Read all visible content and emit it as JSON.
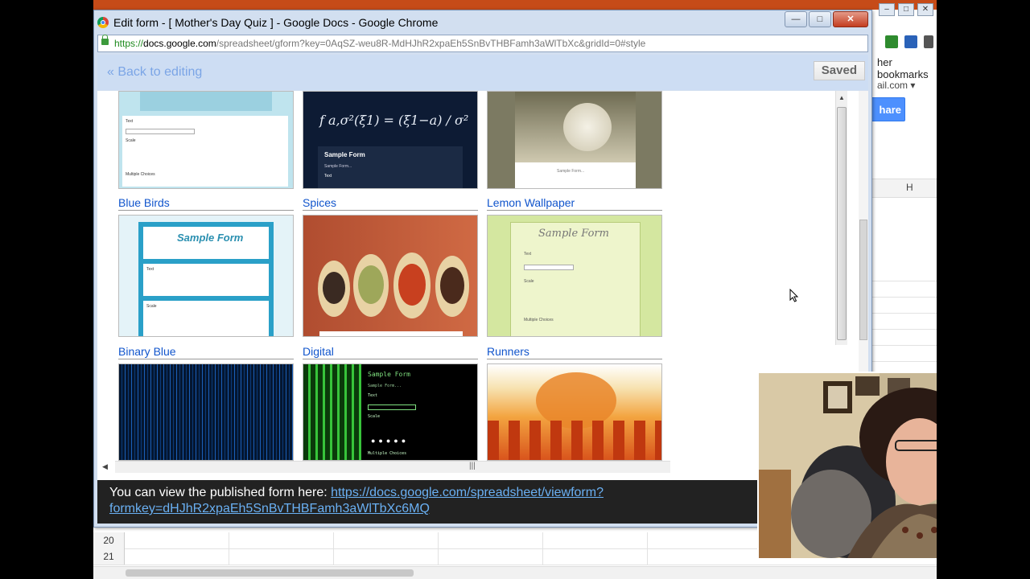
{
  "browser": {
    "window_title": "Edit form - [ Mother's Day Quiz ] - Google Docs - Google Chrome",
    "url_secure": "https://",
    "url_host": "docs.google.com",
    "url_path": "/spreadsheet/gform?key=0AqSZ-weu8R-MdHJhR2xpaEh5SnBvTHBFamh3aWlTbXc&gridId=0#style",
    "controls": {
      "minimize": "—",
      "maximize": "□",
      "close": "✕"
    }
  },
  "editor": {
    "back_link": "« Back to editing",
    "saved_label": "Saved"
  },
  "themes": [
    {
      "label": "",
      "style": "light-teal"
    },
    {
      "label": "",
      "style": "math"
    },
    {
      "label": "",
      "style": "cake"
    },
    {
      "label": "Blue Birds",
      "style": "blue-birds"
    },
    {
      "label": "Spices",
      "style": "spices"
    },
    {
      "label": "Lemon Wallpaper",
      "style": "lemon"
    },
    {
      "label": "Binary Blue",
      "style": "binary-blue"
    },
    {
      "label": "Digital",
      "style": "digital"
    },
    {
      "label": "Runners",
      "style": "runners"
    }
  ],
  "thumb_text": {
    "sample_form": "Sample Form",
    "sample_form_dots": "Sample Form...",
    "text": "Text",
    "scale": "Scale",
    "multiple_choices": "Multiple Choices",
    "formula": "f a,σ²(ξ1) = (ξ1−a) / σ²"
  },
  "published": {
    "prefix": "You can view the published form here: ",
    "link": "https://docs.google.com/spreadsheet/viewform?formkey=dHJhR2xpaEh5SnBvTHBFamh3aWlTbXc6MQ"
  },
  "background_sheet": {
    "bookmarks": "her bookmarks",
    "email": "ail.com ▾",
    "share": "hare",
    "column_h": "H",
    "rows": [
      "20",
      "21"
    ]
  },
  "colors": {
    "link": "#1155cc",
    "chrome_frame": "#d2dff0",
    "share_blue": "#4d90fe"
  }
}
